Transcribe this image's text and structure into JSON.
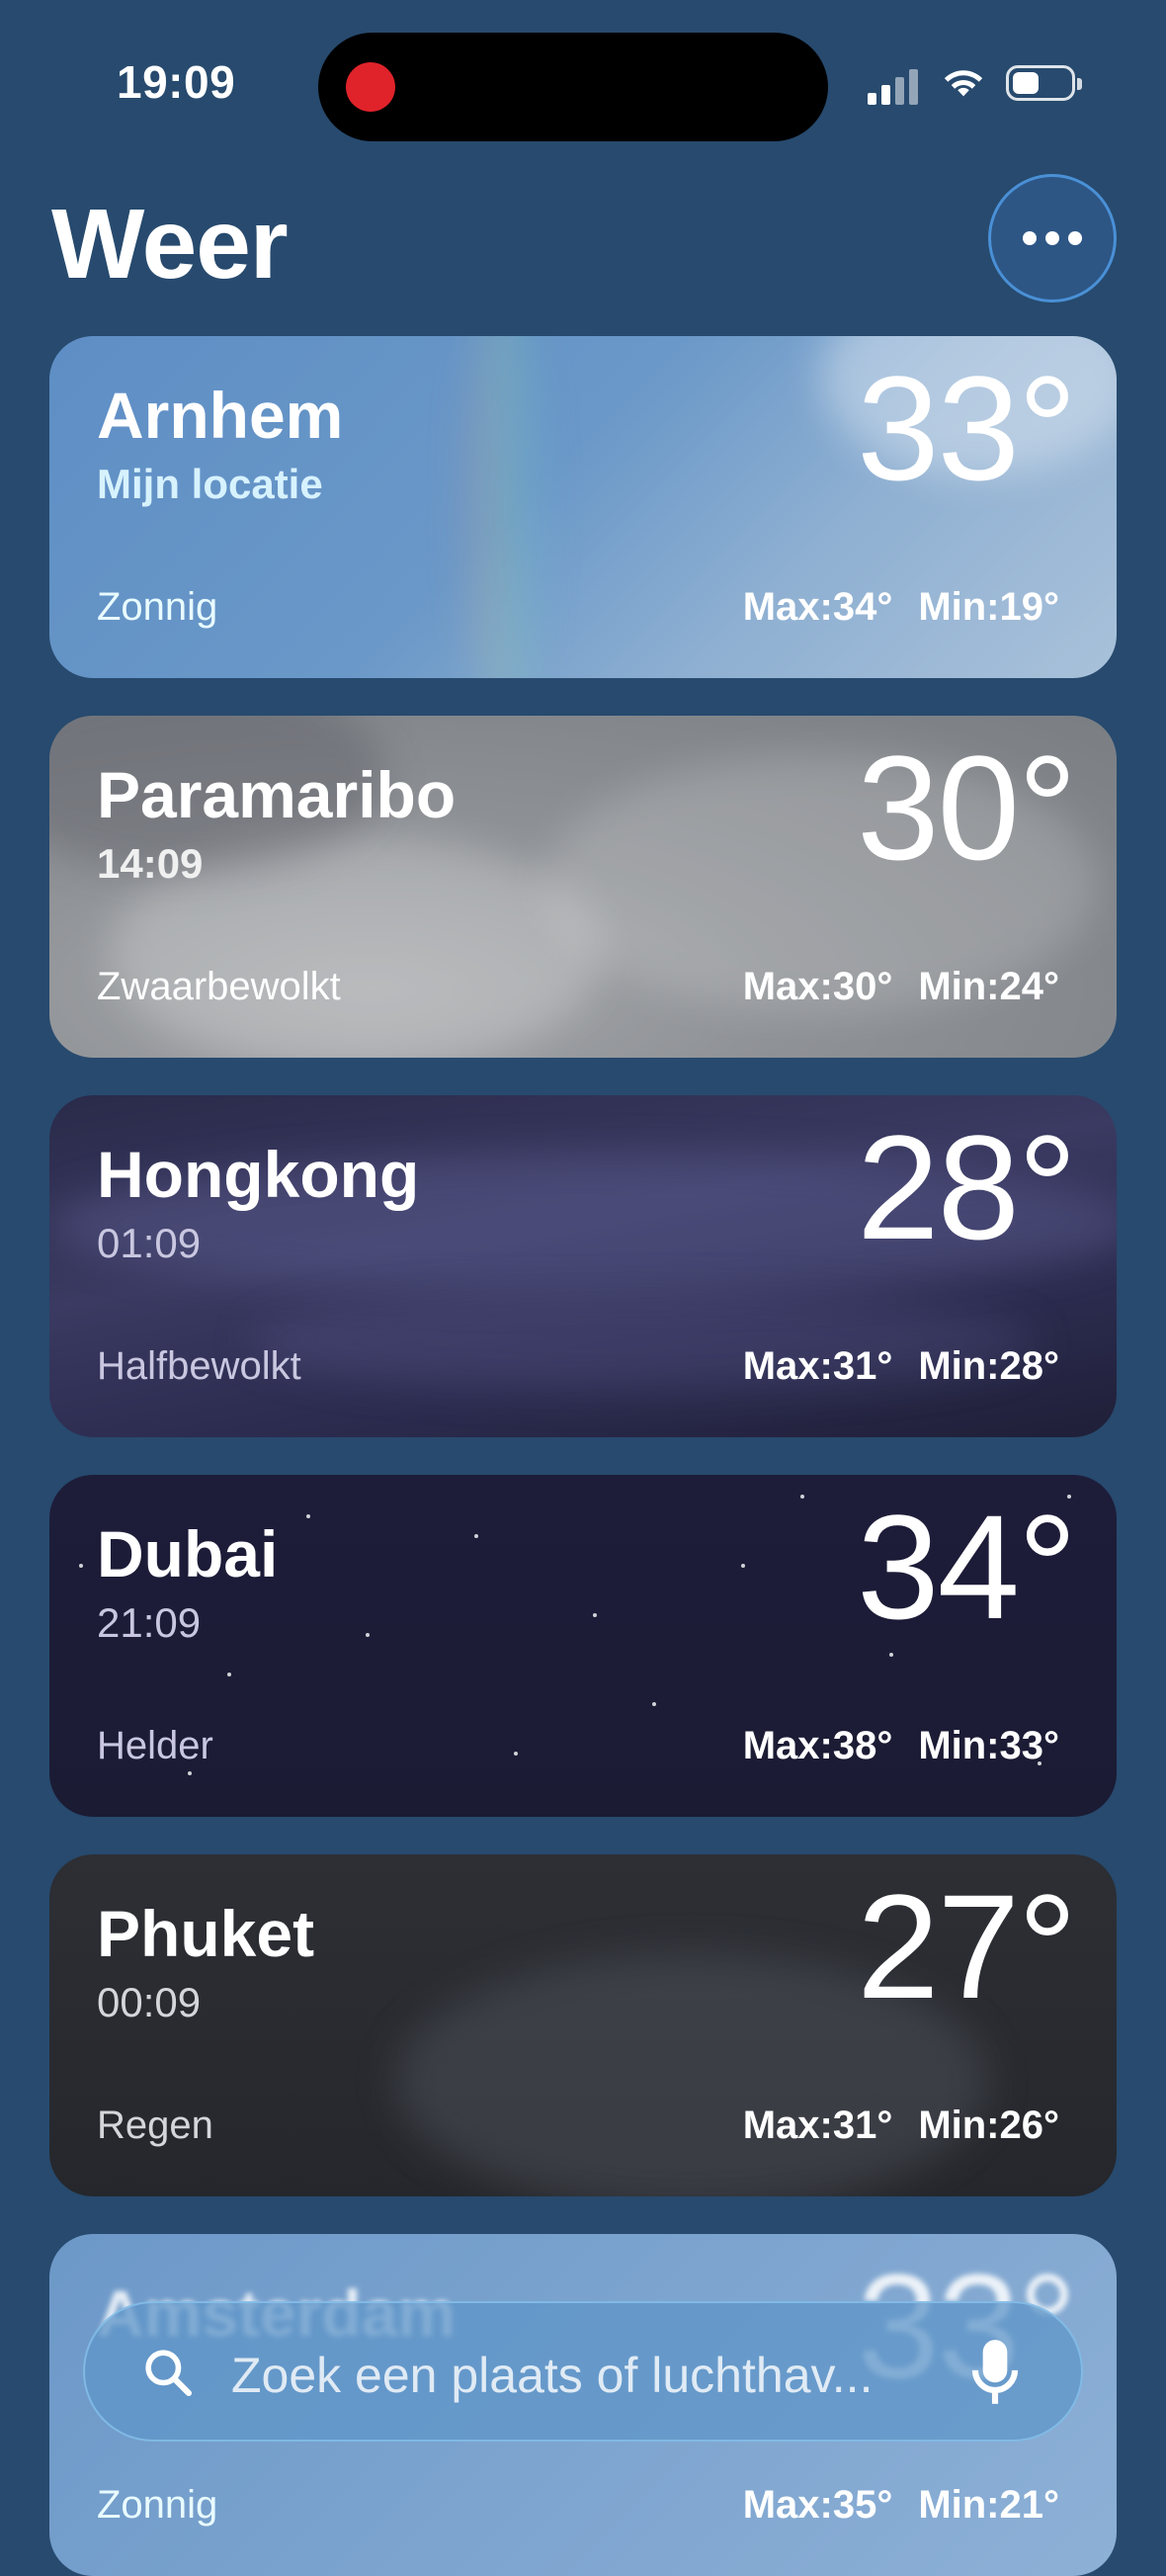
{
  "status_bar": {
    "time": "19:09",
    "recording_color": "#e0232b"
  },
  "header": {
    "title": "Weer",
    "more_icon": "ellipsis-icon"
  },
  "locations": [
    {
      "city": "Arnhem",
      "subtitle": "Mijn locatie",
      "temperature": "33°",
      "condition": "Zonnig",
      "max": "Max:34°",
      "min": "Min:19°"
    },
    {
      "city": "Paramaribo",
      "subtitle": "14:09",
      "temperature": "30°",
      "condition": "Zwaarbewolkt",
      "max": "Max:30°",
      "min": "Min:24°"
    },
    {
      "city": "Hongkong",
      "subtitle": "01:09",
      "temperature": "28°",
      "condition": "Halfbewolkt",
      "max": "Max:31°",
      "min": "Min:28°"
    },
    {
      "city": "Dubai",
      "subtitle": "21:09",
      "temperature": "34°",
      "condition": "Helder",
      "max": "Max:38°",
      "min": "Min:33°"
    },
    {
      "city": "Phuket",
      "subtitle": "00:09",
      "temperature": "27°",
      "condition": "Regen",
      "max": "Max:31°",
      "min": "Min:26°"
    },
    {
      "city": "Amsterdam",
      "subtitle": "",
      "temperature": "33°",
      "condition": "Zonnig",
      "max": "Max:35°",
      "min": "Min:21°"
    }
  ],
  "search": {
    "placeholder": "Zoek een plaats of luchthav...",
    "search_icon": "search-icon",
    "mic_icon": "microphone-icon"
  },
  "colors": {
    "background": "#274a6e",
    "accent": "#4a90d6"
  }
}
